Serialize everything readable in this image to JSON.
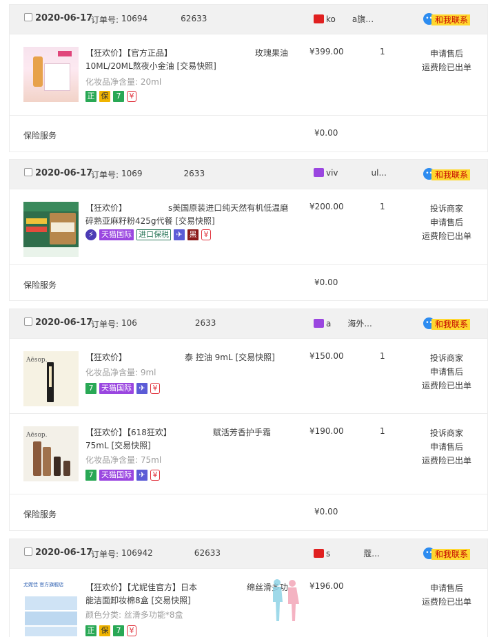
{
  "contact_label": "和我联系",
  "insurance_label": "保险服务",
  "orders": [
    {
      "date": "2020-06-17",
      "order_no_label": "订单号:",
      "order_no": "10694    62633",
      "shop": "ko  a旗…",
      "shop_icon_color": "#e02020",
      "items": [
        {
          "title": "【狂欢价】【官方正品】          玫瑰果油10ML/20ML熬夜小金油 [交易快照]",
          "attr": "化妆品净含量: 20ml",
          "price": "¥399.00",
          "qty": "1",
          "ops": [
            "申请售后",
            "运费险已出单"
          ],
          "badges": [
            "正",
            "保",
            "7",
            "¥"
          ]
        }
      ],
      "insurance_amount": "¥0.00"
    },
    {
      "date": "2020-06-17",
      "order_no_label": "订单号:",
      "order_no": "1069     2633",
      "shop": "viv    ul...",
      "shop_icon_color": "#9a46e0",
      "items": [
        {
          "title": "【狂欢价】     s美国原装进口纯天然有机低温磨碎熟亚麻籽粉425g代餐 [交易快照]",
          "attr": "",
          "price": "¥200.00",
          "qty": "1",
          "ops": [
            "投诉商家",
            "申请售后",
            "运费险已出单"
          ],
          "badges": [
            "⚡",
            "天猫国际",
            "进口保税",
            "✈",
            "黑",
            "¥"
          ]
        }
      ],
      "insurance_amount": "¥0.00"
    },
    {
      "date": "2020-06-17",
      "order_no_label": "订单号:",
      "order_no": "106       2633",
      "shop": "a  海外...",
      "shop_icon_color": "#9a46e0",
      "items": [
        {
          "title": "【狂欢价】       泰 控油 9mL [交易快照]",
          "attr": "化妆品净含量: 9ml",
          "price": "¥150.00",
          "qty": "1",
          "ops": [
            "投诉商家",
            "申请售后",
            "运费险已出单"
          ],
          "badges": [
            "7",
            "天猫国际",
            "✈",
            "¥"
          ]
        },
        {
          "title": "【狂欢价】【618狂欢】     赋活芳香护手霜 75mL [交易快照]",
          "attr": "化妆品净含量: 75ml",
          "price": "¥190.00",
          "qty": "1",
          "ops": [
            "投诉商家",
            "申请售后",
            "运费险已出单"
          ],
          "badges": [
            "7",
            "天猫国际",
            "✈",
            "¥"
          ]
        }
      ],
      "insurance_amount": "¥0.00"
    },
    {
      "date": "2020-06-17",
      "order_no_label": "订单号:",
      "order_no": "106942     62633",
      "shop": "s    蔻...",
      "shop_icon_color": "#e02020",
      "items": [
        {
          "title": "【狂欢价】【尤妮佳官方】日本      绵丝滑多功能洁面卸妆棉8盒 [交易快照]",
          "attr": "颜色分类: 丝滑多功能*8盒",
          "price": "¥196.00",
          "qty": "",
          "ops": [
            "申请售后",
            "运费险已出单"
          ],
          "badges": [
            "正",
            "保",
            "7",
            "¥"
          ]
        }
      ],
      "insurance_amount": ""
    }
  ]
}
